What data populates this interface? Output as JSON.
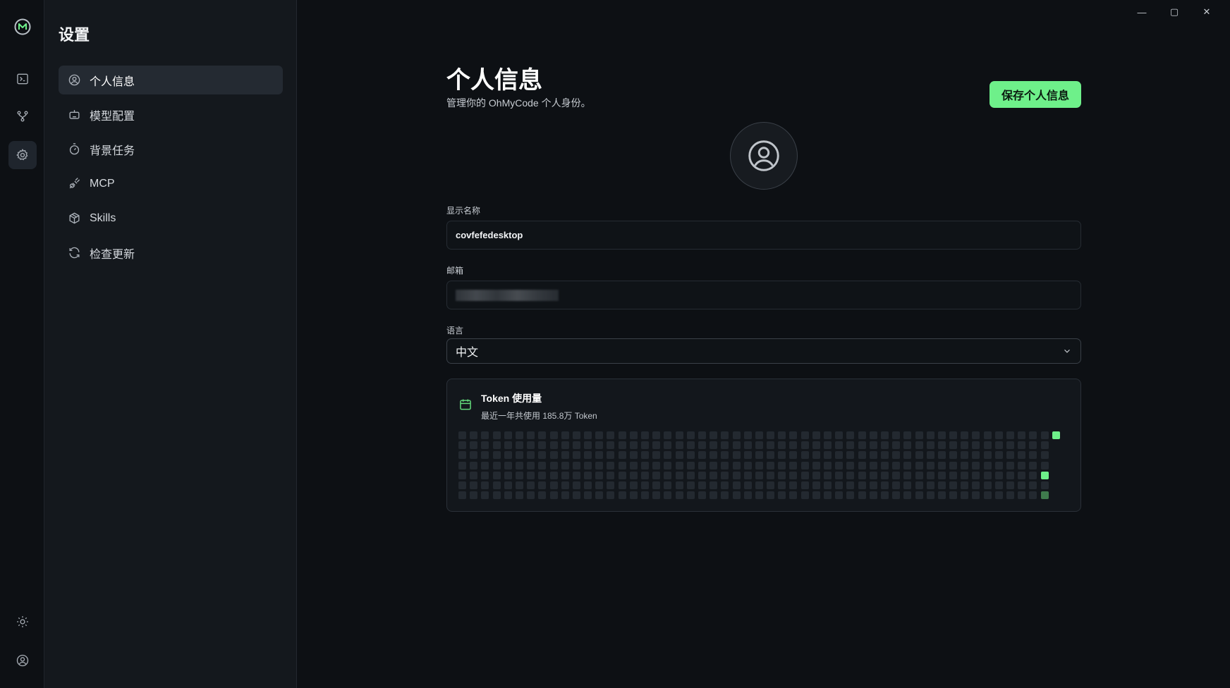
{
  "rail": {
    "items": [
      {
        "name": "terminal-icon"
      },
      {
        "name": "git-branch-icon"
      },
      {
        "name": "gear-icon",
        "active": true
      }
    ],
    "bottom": [
      {
        "name": "sun-icon"
      },
      {
        "name": "user-circle-icon"
      }
    ]
  },
  "sidebar": {
    "title": "设置",
    "items": [
      {
        "label": "个人信息",
        "icon": "user-circle-icon",
        "active": true
      },
      {
        "label": "模型配置",
        "icon": "robot-icon"
      },
      {
        "label": "背景任务",
        "icon": "timer-icon"
      },
      {
        "label": "MCP",
        "icon": "plug-icon"
      },
      {
        "label": "Skills",
        "icon": "package-icon"
      },
      {
        "label": "检查更新",
        "icon": "refresh-icon"
      }
    ]
  },
  "window": {
    "minimize": "—",
    "maximize": "▢",
    "close": "✕"
  },
  "profile": {
    "title": "个人信息",
    "subtitle": "管理你的 OhMyCode 个人身份。",
    "save_label": "保存个人信息",
    "display_name_label": "显示名称",
    "display_name_value": "covfefedesktop",
    "email_label": "邮箱",
    "language_label": "语言",
    "language_value": "中文"
  },
  "token_usage": {
    "title": "Token 使用量",
    "summary": "最近一年共使用 185.8万 Token",
    "weeks": 53,
    "days_per_week": 7,
    "active_cells": [
      {
        "week": 52,
        "day": 0,
        "level": 3
      },
      {
        "week": 51,
        "day": 4,
        "level": 3
      },
      {
        "week": 51,
        "day": 6,
        "level": 1
      }
    ]
  },
  "colors": {
    "accent": "#6ef08a",
    "background": "#0d1014",
    "sidebar": "#14181d",
    "card": "#13171c"
  }
}
